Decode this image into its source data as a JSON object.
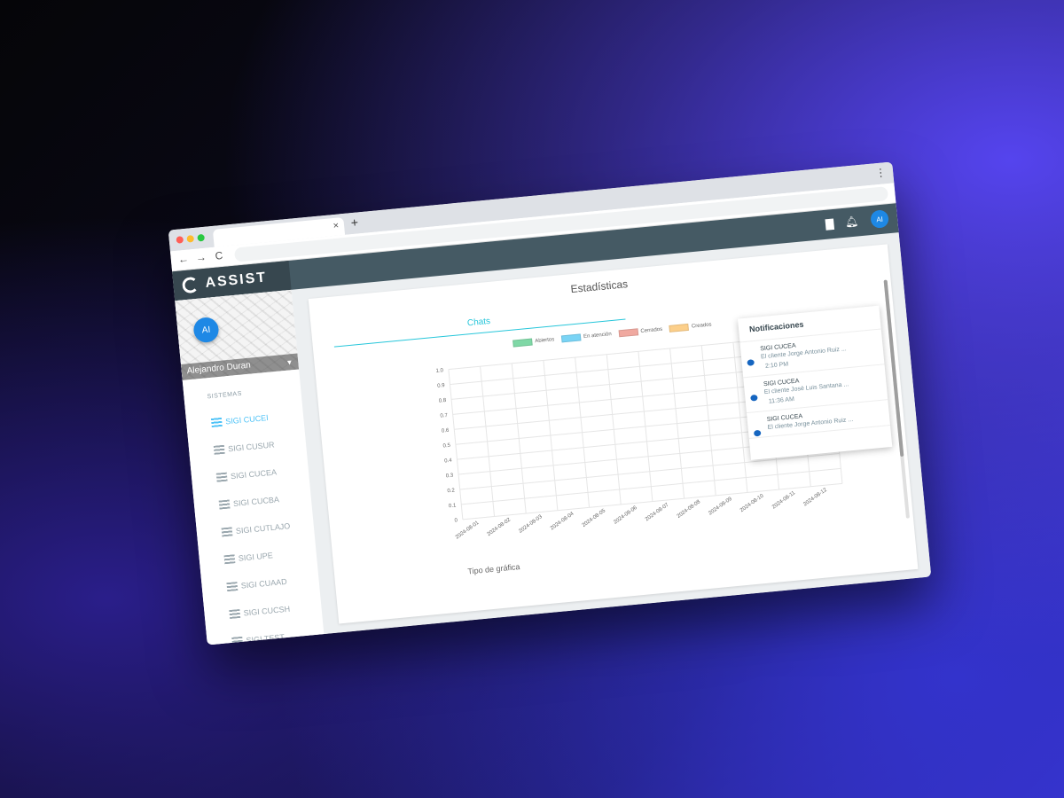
{
  "browser": {
    "tab_close": "×",
    "new_tab": "+",
    "menu": "⋮"
  },
  "nav": {
    "back": "←",
    "forward": "→",
    "reload": "C"
  },
  "app": {
    "brand": "ASSIST",
    "user_initials": "AI",
    "user_name": "Alejandro Duran"
  },
  "sidebar": {
    "section_label": "SISTEMAS",
    "items": [
      {
        "label": "SIGI CUCEI",
        "active": true
      },
      {
        "label": "SIGI CUSUR"
      },
      {
        "label": "SIGI CUCEA"
      },
      {
        "label": "SIGI CUCBA"
      },
      {
        "label": "SIGI CUTLAJO"
      },
      {
        "label": "SIGI UPE"
      },
      {
        "label": "SIGI CUAAD"
      },
      {
        "label": "SIGI CUCSH"
      },
      {
        "label": "SIGI TEST"
      }
    ]
  },
  "main": {
    "title": "Estadísticas",
    "tab": "Chats",
    "chart_type_label": "Tipo de gráfica"
  },
  "notifications": {
    "title": "Notificaciones",
    "items": [
      {
        "system": "SIGI CUCEA",
        "message": "El cliente Jorge Antonio Ruiz ...",
        "time": "2:10 PM"
      },
      {
        "system": "SIGI CUCEA",
        "message": "El cliente José Luis Santana ...",
        "time": "11:36 AM"
      },
      {
        "system": "SIGI CUCEA",
        "message": "El cliente Jorge Antonio Ruiz ...",
        "time": ""
      }
    ]
  },
  "chart_data": {
    "type": "bar",
    "categories": [
      "2024-08-01",
      "2024-08-02",
      "2024-08-03",
      "2024-08-04",
      "2024-08-05",
      "2024-08-06",
      "2024-08-07",
      "2024-08-08",
      "2024-08-09",
      "2024-08-10",
      "2024-08-11",
      "2024-08-12"
    ],
    "series": [
      {
        "name": "Abiertos",
        "color": "#7fd8a6",
        "values": [
          0,
          0,
          0,
          0,
          0,
          0,
          0,
          0,
          0,
          0,
          0,
          0
        ]
      },
      {
        "name": "En atención",
        "color": "#7ad4f5",
        "values": [
          0,
          0,
          0,
          0,
          0,
          0,
          0,
          0,
          0,
          0,
          0,
          0
        ]
      },
      {
        "name": "Cerrados",
        "color": "#f0a9a0",
        "values": [
          0,
          0,
          0,
          0,
          0,
          0,
          0,
          0,
          0,
          0,
          0,
          0
        ]
      },
      {
        "name": "Creados",
        "color": "#fccf8a",
        "values": [
          0,
          0,
          0,
          0,
          0,
          0,
          0,
          0,
          0,
          0,
          0,
          0
        ]
      }
    ],
    "yticks": [
      "1.0",
      "0.9",
      "0.8",
      "0.7",
      "0.6",
      "0.5",
      "0.4",
      "0.3",
      "0.2",
      "0.1",
      "0"
    ],
    "ylim": [
      0,
      1
    ],
    "grid": true,
    "legend": "top"
  }
}
